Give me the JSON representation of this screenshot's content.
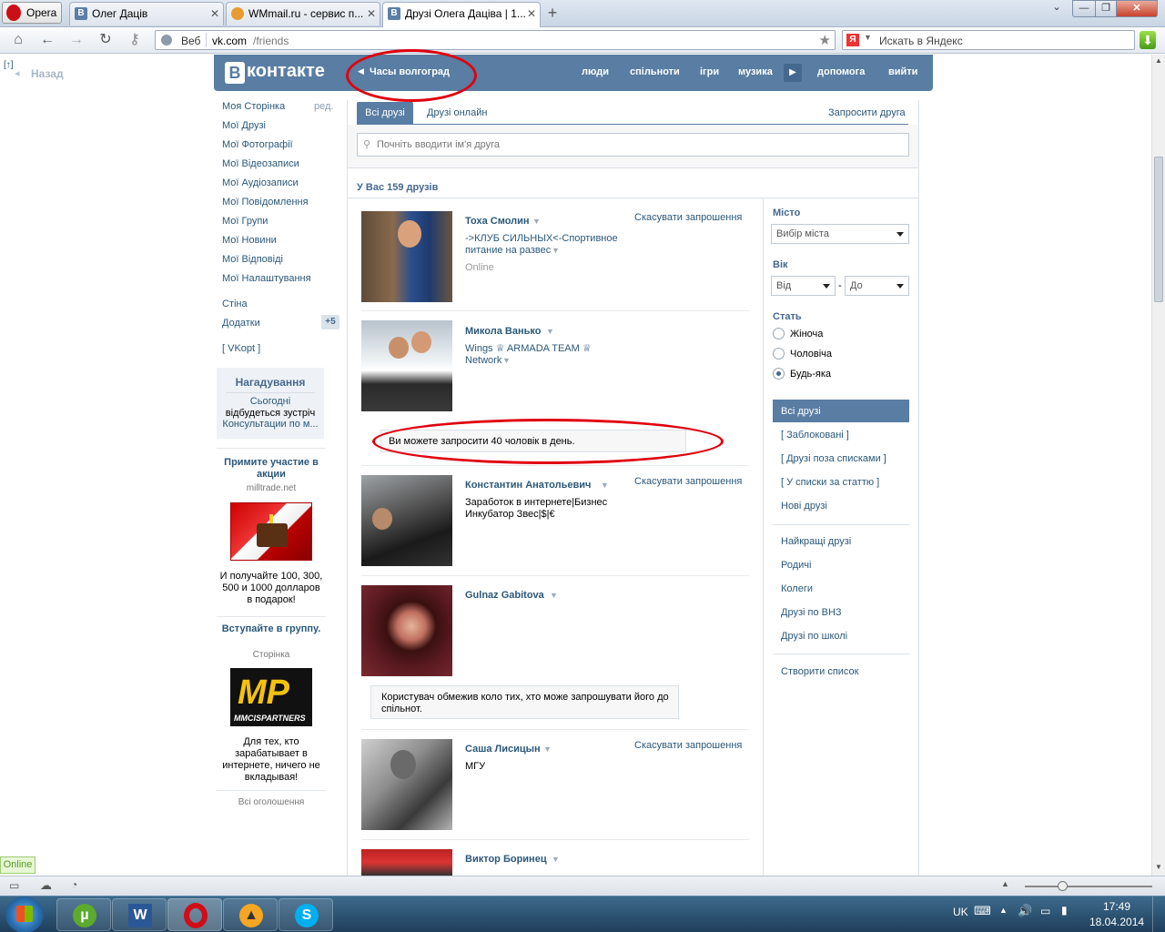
{
  "browser": {
    "opera_button": "Opera",
    "tabs": [
      {
        "label": "Олег Даців"
      },
      {
        "label": "WMmail.ru - сервис п..."
      },
      {
        "label": "Друзі Олега Даціва | 1..."
      }
    ],
    "address": {
      "prefix": "Веб",
      "url_host": "vk.com",
      "url_path": "/friends"
    },
    "search_placeholder": "Искать в Яндекс",
    "back_label": "Назад"
  },
  "vk": {
    "logo": "контакте",
    "logo_b": "В",
    "status": "Часы волгоград",
    "top_nav": [
      "люди",
      "спільноти",
      "ігри",
      "музика",
      "допомога",
      "вийти"
    ],
    "left_menu": [
      "Моя Сторінка",
      "Мої Друзі",
      "Мої Фотографії",
      "Мої Відеозаписи",
      "Мої Аудіозаписи",
      "Мої Повідомлення",
      "Мої Групи",
      "Мої Новини",
      "Мої Відповіді",
      "Мої Налаштування"
    ],
    "edit_label": "ред.",
    "wall": "Стіна",
    "apps": "Додатки",
    "apps_badge": "+5",
    "vkopt": "[ VKopt ]",
    "reminder": {
      "title": "Нагадування",
      "line1": "Сьогодні",
      "line2": "відбудеться зустріч",
      "line3": "Консультации по м..."
    },
    "ad1": {
      "title": "Примите участие в акции",
      "site": "milltrade.net",
      "text": "И получайте 100, 300, 500 и 1000 долларов в подарок!"
    },
    "ad2": {
      "title": "Вступайте в группу.",
      "site": "Сторінка",
      "logo": "MP",
      "logo_sub": "MMCISPARTNERS",
      "text": "Для тех, кто зарабатывает в интернете, ничего не вкладывая!"
    },
    "all_ads": "Всі оголошення",
    "tabs": {
      "all": "Всі друзі",
      "online": "Друзі онлайн",
      "invite": "Запросити друга"
    },
    "search_placeholder": "Почніть вводити ім'я друга",
    "count": "У Вас 159 друзів",
    "friends": [
      {
        "name": "Тоха Смолин",
        "sub1": "->КЛУБ СИЛЬНЫХ<-Спортивное",
        "sub2": "питание на развес",
        "status": "Online",
        "action": "Скасувати запрошення"
      },
      {
        "name": "Микола Ванько",
        "sub1": "Wings ♕ ARMADA TEAM ♕",
        "sub2": "Network",
        "status": "",
        "action": ""
      },
      {
        "name": "Константин Анатольевич",
        "sub1": "Заработок в интернете|Бизнес",
        "sub2": "Инкубатор Звес|$|€",
        "status": "",
        "action": "Скасувати запрошення"
      },
      {
        "name": "Gulnaz Gabitova",
        "sub1": "",
        "sub2": "",
        "status": "",
        "action": ""
      },
      {
        "name": "Саша Лисицын",
        "sub1": "МГУ",
        "sub2": "",
        "status": "",
        "action": "Скасувати запрошення"
      },
      {
        "name": "Виктор Боринец",
        "sub1": "",
        "sub2": "",
        "status": "",
        "action": ""
      }
    ],
    "notice_limit": "Ви можете запросити 40 чоловік в день.",
    "notice_restricted": "Користувач обмежив коло тих, хто може запрошувати його до спільнот.",
    "filters": {
      "city_label": "Місто",
      "city_value": "Вибір міста",
      "age_label": "Вік",
      "age_from": "Від",
      "age_to": "До",
      "age_dash": "-",
      "sex_label": "Стать",
      "sex_options": [
        "Жіноча",
        "Чоловіча",
        "Будь-яка"
      ]
    },
    "right_lists_1": [
      "Всі друзі",
      "[ Заблоковані ]",
      "[ Друзі поза списками ]",
      "[ У списки за статтю ]",
      "Нові друзі"
    ],
    "right_lists_2": [
      "Найкращі друзі",
      "Родичі",
      "Колеги",
      "Друзі по ВНЗ",
      "Друзі по школі"
    ],
    "create_list": "Створити список"
  },
  "statusbar": {
    "online": "Online"
  },
  "taskbar": {
    "lang": "UK",
    "time": "17:49",
    "date": "18.04.2014"
  },
  "colors": {
    "vk_blue": "#597da3",
    "link": "#2b587a",
    "annotation_red": "#e0000e"
  }
}
